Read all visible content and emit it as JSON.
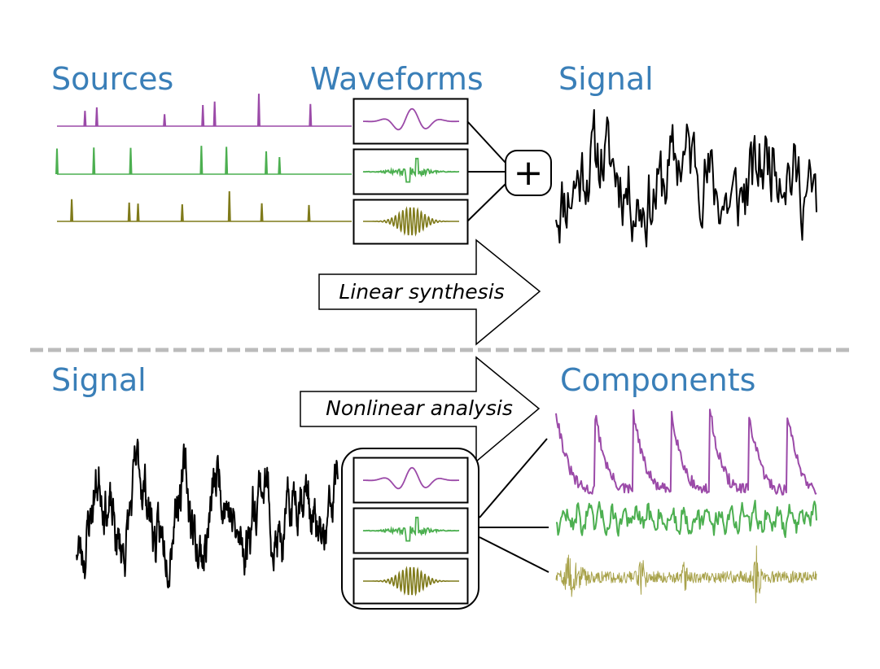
{
  "colors": {
    "title": "#3a7fb8",
    "source_1": "#9b4aa8",
    "source_2": "#4caf50",
    "source_3": "#7f7a1a",
    "component_3_light": "#a8a24a",
    "signal": "#000000",
    "divider": "#bbbbbb"
  },
  "top": {
    "titles": {
      "sources": "Sources",
      "waveforms": "Waveforms",
      "signal": "Signal"
    },
    "sum_symbol": "+",
    "arrow_label": "Linear synthesis",
    "sources": [
      {
        "name": "source-1",
        "color_key": "source_1",
        "spikes": [
          [
            0.095,
            0.45
          ],
          [
            0.135,
            0.55
          ],
          [
            0.365,
            0.35
          ],
          [
            0.495,
            0.62
          ],
          [
            0.535,
            0.72
          ],
          [
            0.685,
            0.95
          ],
          [
            0.86,
            0.65
          ]
        ]
      },
      {
        "name": "source-2",
        "color_key": "source_2",
        "spikes": [
          [
            0.0,
            0.75
          ],
          [
            0.125,
            0.78
          ],
          [
            0.25,
            0.77
          ],
          [
            0.49,
            0.83
          ],
          [
            0.575,
            0.8
          ],
          [
            0.71,
            0.67
          ],
          [
            0.755,
            0.5
          ]
        ]
      },
      {
        "name": "source-3",
        "color_key": "source_3",
        "spikes": [
          [
            0.05,
            0.65
          ],
          [
            0.245,
            0.55
          ],
          [
            0.275,
            0.52
          ],
          [
            0.425,
            0.5
          ],
          [
            0.585,
            0.88
          ],
          [
            0.695,
            0.53
          ],
          [
            0.855,
            0.48
          ]
        ]
      }
    ],
    "waveforms": [
      {
        "name": "waveform-1",
        "color_key": "source_1",
        "kind": "smooth"
      },
      {
        "name": "waveform-2",
        "color_key": "source_2",
        "kind": "jagged"
      },
      {
        "name": "waveform-3",
        "color_key": "source_3",
        "kind": "chirp"
      }
    ]
  },
  "bottom": {
    "titles": {
      "signal": "Signal",
      "components": "Components"
    },
    "arrow_label": "Nonlinear analysis",
    "waveforms": [
      {
        "name": "waveform-1",
        "color_key": "source_1",
        "kind": "smooth"
      },
      {
        "name": "waveform-2",
        "color_key": "source_2",
        "kind": "jagged"
      },
      {
        "name": "waveform-3",
        "color_key": "source_3",
        "kind": "chirp"
      }
    ],
    "components": [
      {
        "name": "component-1",
        "color_key": "source_1"
      },
      {
        "name": "component-2",
        "color_key": "source_2"
      },
      {
        "name": "component-3",
        "color_key": "component_3_light"
      }
    ]
  }
}
